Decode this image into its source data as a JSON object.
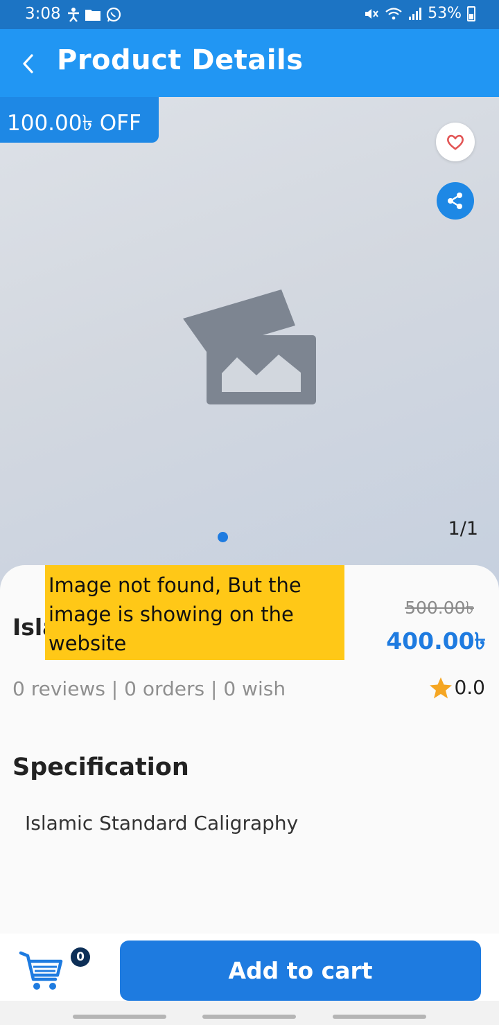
{
  "status_bar": {
    "time": "3:08",
    "battery": "53%",
    "left_icons": [
      "accessibility-icon",
      "folder-icon",
      "whatsapp-icon"
    ],
    "right_icons": [
      "mute-icon",
      "wifi-icon",
      "signal-icon",
      "battery-icon"
    ]
  },
  "app_bar": {
    "title": "Product Details",
    "background": "#2196f3"
  },
  "hero": {
    "discount_label": "100.00৳ OFF",
    "page_counter": "1/1",
    "favorite_icon": "heart-outline-icon",
    "share_icon": "share-icon",
    "placeholder_icon": "image-placeholder-icon"
  },
  "product": {
    "name": "Isla",
    "old_price": "500.00৳",
    "new_price": "400.00৳",
    "stats": "0 reviews | 0 orders | 0 wish",
    "rating": "0.0"
  },
  "note": {
    "text": "Image not found, But the image is showing on the website"
  },
  "specification": {
    "heading": "Specification",
    "text": "Islamic Standard Caligraphy"
  },
  "bottom_bar": {
    "cart_count": "0",
    "add_to_cart_label": "Add to cart"
  },
  "colors": {
    "accent": "#1e7be0",
    "status_bar": "#1c74c4",
    "note_background": "#ffc817",
    "star": "#f5a623"
  }
}
